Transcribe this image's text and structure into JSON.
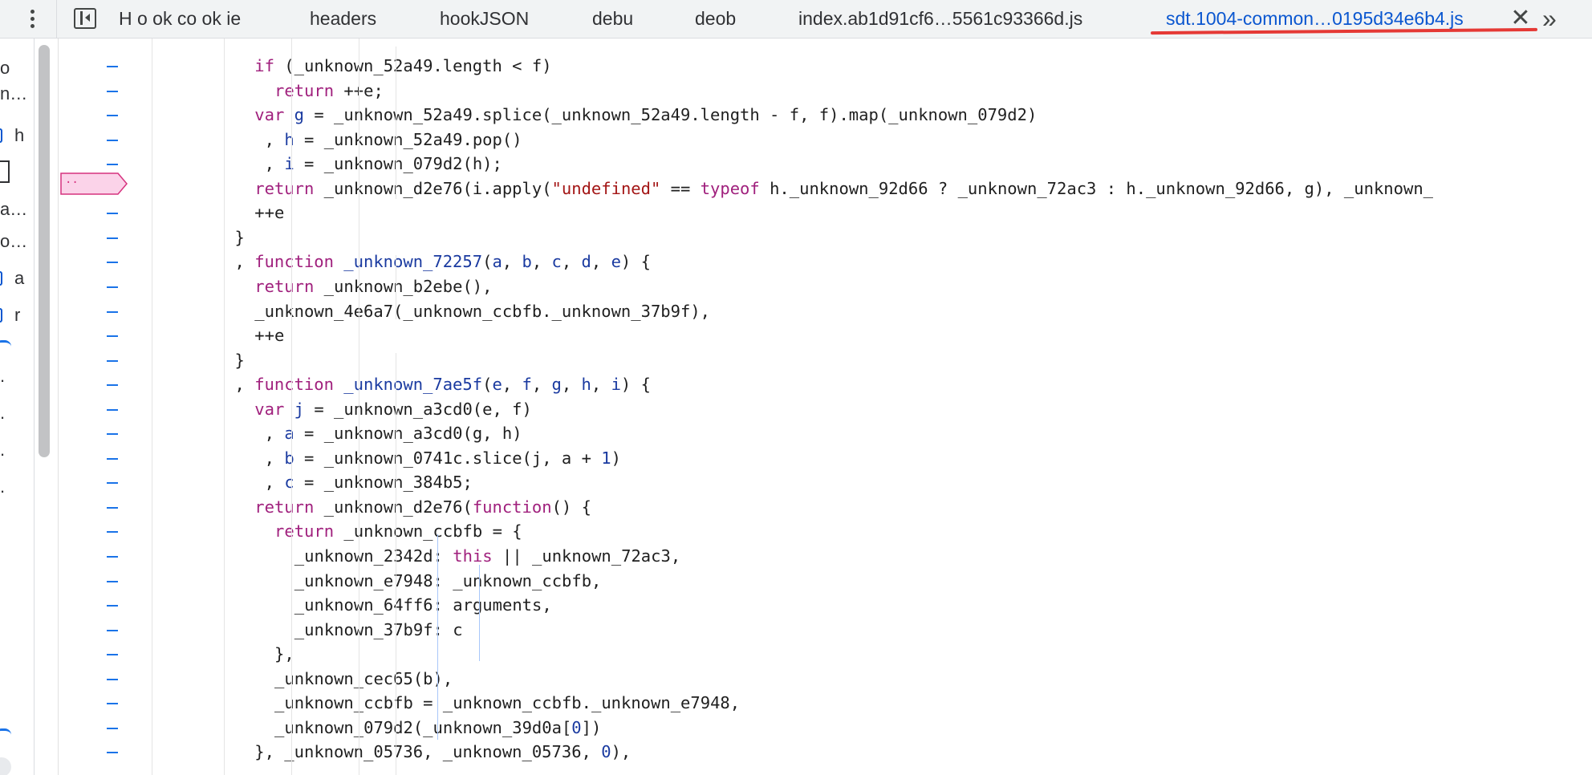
{
  "tabs": [
    {
      "label": "H o ok co ok ie",
      "active": false
    },
    {
      "label": "headers",
      "active": false
    },
    {
      "label": "hookJSON",
      "active": false
    },
    {
      "label": "debu",
      "active": false
    },
    {
      "label": "deob",
      "active": false
    },
    {
      "label": "index.ab1d91cf6…5561c93366d.js",
      "active": false
    },
    {
      "label": "sdt.1004-common…0195d34e6b4.js",
      "active": true
    }
  ],
  "close_glyph": "✕",
  "more_glyph": "»",
  "navigator": {
    "fragments": [
      "o",
      "n…",
      "h",
      "",
      "a…",
      "o…",
      "a",
      "r",
      "",
      ".",
      ".",
      ".",
      "."
    ]
  },
  "breakpoint_label": "··",
  "colors": {
    "accent": "#0b57d0",
    "keyword": "#a0207d",
    "string": "#a31515",
    "annotation_underline": "#e53935",
    "breakpoint_fill": "#fbd3e9",
    "breakpoint_border": "#d6337f"
  },
  "code_lines": [
    {
      "indent": 6,
      "tokens": [
        [
          "kw",
          "if"
        ],
        [
          "fn",
          " (_unknown_52a49.length < f)"
        ]
      ]
    },
    {
      "indent": 8,
      "tokens": [
        [
          "kw",
          "return"
        ],
        [
          "fn",
          " ++e;"
        ]
      ]
    },
    {
      "indent": 6,
      "tokens": [
        [
          "kw",
          "var"
        ],
        [
          "fn",
          " "
        ],
        [
          "def",
          "g"
        ],
        [
          "fn",
          " = _unknown_52a49.splice(_unknown_52a49.length - f, f).map(_unknown_079d2)"
        ]
      ]
    },
    {
      "indent": 7,
      "tokens": [
        [
          "fn",
          ", "
        ],
        [
          "def",
          "h"
        ],
        [
          "fn",
          " = _unknown_52a49.pop()"
        ]
      ]
    },
    {
      "indent": 7,
      "tokens": [
        [
          "fn",
          ", "
        ],
        [
          "def",
          "i"
        ],
        [
          "fn",
          " = _unknown_079d2(h);"
        ]
      ]
    },
    {
      "indent": 6,
      "tokens": [
        [
          "kw",
          "return"
        ],
        [
          "fn",
          " _unknown_d2e76(i.apply("
        ],
        [
          "str",
          "\"undefined\""
        ],
        [
          "fn",
          " == "
        ],
        [
          "kw",
          "typeof"
        ],
        [
          "fn",
          " h._unknown_92d66 ? _unknown_72ac3 : h._unknown_92d66, g), _unknown_"
        ]
      ]
    },
    {
      "indent": 6,
      "tokens": [
        [
          "fn",
          "++e"
        ]
      ]
    },
    {
      "indent": 4,
      "tokens": [
        [
          "fn",
          "}"
        ]
      ]
    },
    {
      "indent": 4,
      "tokens": [
        [
          "fn",
          ", "
        ],
        [
          "kw",
          "function"
        ],
        [
          "fn",
          " "
        ],
        [
          "def",
          "_unknown_72257"
        ],
        [
          "fn",
          "("
        ],
        [
          "p",
          "a"
        ],
        [
          "fn",
          ", "
        ],
        [
          "p",
          "b"
        ],
        [
          "fn",
          ", "
        ],
        [
          "p",
          "c"
        ],
        [
          "fn",
          ", "
        ],
        [
          "p",
          "d"
        ],
        [
          "fn",
          ", "
        ],
        [
          "p",
          "e"
        ],
        [
          "fn",
          ") {"
        ]
      ]
    },
    {
      "indent": 6,
      "tokens": [
        [
          "kw",
          "return"
        ],
        [
          "fn",
          " _unknown_b2ebe(),"
        ]
      ]
    },
    {
      "indent": 6,
      "tokens": [
        [
          "fn",
          "_unknown_4e6a7(_unknown_ccbfb._unknown_37b9f),"
        ]
      ]
    },
    {
      "indent": 6,
      "tokens": [
        [
          "fn",
          "++e"
        ]
      ]
    },
    {
      "indent": 4,
      "tokens": [
        [
          "fn",
          "}"
        ]
      ]
    },
    {
      "indent": 4,
      "tokens": [
        [
          "fn",
          ", "
        ],
        [
          "kw",
          "function"
        ],
        [
          "fn",
          " "
        ],
        [
          "def",
          "_unknown_7ae5f"
        ],
        [
          "fn",
          "("
        ],
        [
          "p",
          "e"
        ],
        [
          "fn",
          ", "
        ],
        [
          "p",
          "f"
        ],
        [
          "fn",
          ", "
        ],
        [
          "p",
          "g"
        ],
        [
          "fn",
          ", "
        ],
        [
          "p",
          "h"
        ],
        [
          "fn",
          ", "
        ],
        [
          "p",
          "i"
        ],
        [
          "fn",
          ") {"
        ]
      ]
    },
    {
      "indent": 6,
      "tokens": [
        [
          "kw",
          "var"
        ],
        [
          "fn",
          " "
        ],
        [
          "def",
          "j"
        ],
        [
          "fn",
          " = _unknown_a3cd0(e, f)"
        ]
      ]
    },
    {
      "indent": 7,
      "tokens": [
        [
          "fn",
          ", "
        ],
        [
          "def",
          "a"
        ],
        [
          "fn",
          " = _unknown_a3cd0(g, h)"
        ]
      ]
    },
    {
      "indent": 7,
      "tokens": [
        [
          "fn",
          ", "
        ],
        [
          "def",
          "b"
        ],
        [
          "fn",
          " = _unknown_0741c.slice(j, a + "
        ],
        [
          "num",
          "1"
        ],
        [
          "fn",
          ")"
        ]
      ]
    },
    {
      "indent": 7,
      "tokens": [
        [
          "fn",
          ", "
        ],
        [
          "def",
          "c"
        ],
        [
          "fn",
          " = _unknown_384b5;"
        ]
      ]
    },
    {
      "indent": 6,
      "tokens": [
        [
          "kw",
          "return"
        ],
        [
          "fn",
          " _unknown_d2e76("
        ],
        [
          "kw",
          "function"
        ],
        [
          "fn",
          "() {"
        ]
      ]
    },
    {
      "indent": 8,
      "tokens": [
        [
          "kw",
          "return"
        ],
        [
          "fn",
          " _unknown_ccbfb = {"
        ]
      ]
    },
    {
      "indent": 10,
      "tokens": [
        [
          "fn",
          "_unknown_2342d: "
        ],
        [
          "kw",
          "this"
        ],
        [
          "fn",
          " || _unknown_72ac3,"
        ]
      ]
    },
    {
      "indent": 10,
      "tokens": [
        [
          "fn",
          "_unknown_e7948: _unknown_ccbfb,"
        ]
      ]
    },
    {
      "indent": 10,
      "tokens": [
        [
          "fn",
          "_unknown_64ff6: arguments,"
        ]
      ]
    },
    {
      "indent": 10,
      "tokens": [
        [
          "fn",
          "_unknown_37b9f: c"
        ]
      ]
    },
    {
      "indent": 8,
      "tokens": [
        [
          "fn",
          "},"
        ]
      ]
    },
    {
      "indent": 8,
      "tokens": [
        [
          "fn",
          "_unknown_cec65(b),"
        ]
      ]
    },
    {
      "indent": 8,
      "tokens": [
        [
          "fn",
          "_unknown_ccbfb = _unknown_ccbfb._unknown_e7948,"
        ]
      ]
    },
    {
      "indent": 8,
      "tokens": [
        [
          "fn",
          "_unknown_079d2(_unknown_39d0a["
        ],
        [
          "num",
          "0"
        ],
        [
          "fn",
          "])"
        ]
      ]
    },
    {
      "indent": 6,
      "tokens": [
        [
          "fn",
          "}, _unknown_05736, _unknown_05736, "
        ],
        [
          "num",
          "0"
        ],
        [
          "fn",
          "),"
        ]
      ]
    }
  ]
}
